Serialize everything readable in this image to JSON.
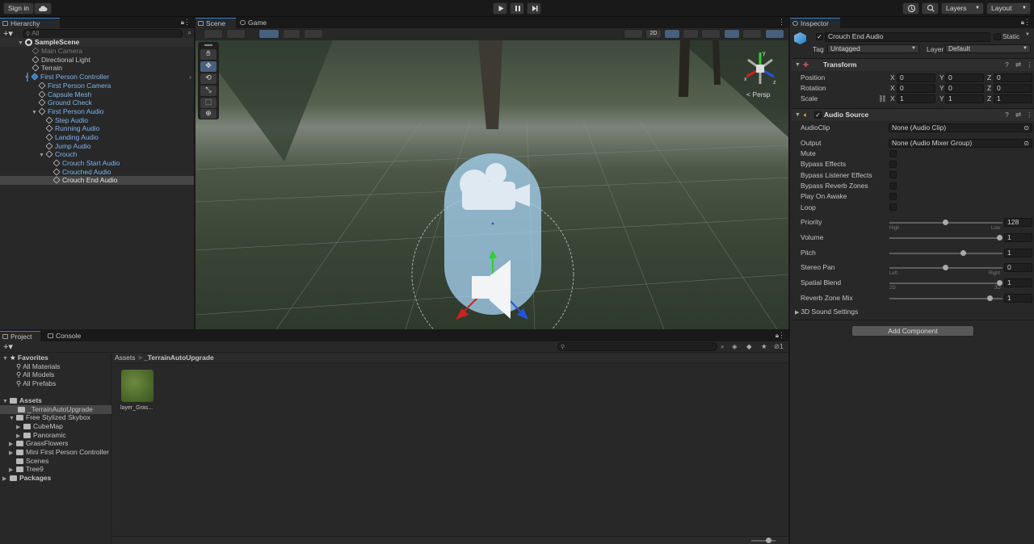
{
  "toolbar": {
    "sign_in": "Sign in",
    "layers": "Layers",
    "layout": "Layout"
  },
  "hierarchy": {
    "tab": "Hierarchy",
    "search_placeholder": "All",
    "scene": "SampleScene",
    "items": [
      "Main Camera",
      "Directional Light",
      "Terrain",
      "First Person Controller",
      "First Person Camera",
      "Capsule Mesh",
      "Ground Check",
      "First Person Audio",
      "Step Audio",
      "Running Audio",
      "Landing Audio",
      "Jump Audio",
      "Crouch",
      "Crouch Start Audio",
      "Crouched Audio",
      "Crouch End Audio"
    ]
  },
  "scene_view": {
    "tab_scene": "Scene",
    "tab_game": "Game",
    "btn_2d": "2D",
    "gizmo_label": "< Persp"
  },
  "project": {
    "tab_project": "Project",
    "tab_console": "Console",
    "favorites_header": "Favorites",
    "favorites": [
      "All Materials",
      "All Models",
      "All Prefabs"
    ],
    "assets_header": "Assets",
    "tree": [
      "_TerrainAutoUpgrade",
      "Free Stylized Skybox",
      "CubeMap",
      "Panoramic",
      "GrassFlowers",
      "Mini First Person Controller",
      "Scenes",
      "Tree9"
    ],
    "packages_header": "Packages",
    "breadcrumb_root": "Assets",
    "breadcrumb_current": "_TerrainAutoUpgrade",
    "asset_label": "layer_Gras...",
    "hidden_count": "1"
  },
  "inspector": {
    "tab": "Inspector",
    "object_name": "Crouch End Audio",
    "static_label": "Static",
    "tag_label": "Tag",
    "tag_value": "Untagged",
    "layer_label": "Layer",
    "layer_value": "Default",
    "transform": {
      "title": "Transform",
      "position_label": "Position",
      "rotation_label": "Rotation",
      "scale_label": "Scale",
      "position": [
        "0",
        "0",
        "0"
      ],
      "rotation": [
        "0",
        "0",
        "0"
      ],
      "scale": [
        "1",
        "1",
        "1"
      ],
      "axis_x": "X",
      "axis_y": "Y",
      "axis_z": "Z"
    },
    "audio_source": {
      "title": "Audio Source",
      "audioclip_label": "AudioClip",
      "audioclip_value": "None (Audio Clip)",
      "output_label": "Output",
      "output_value": "None (Audio Mixer Group)",
      "toggles": [
        "Mute",
        "Bypass Effects",
        "Bypass Listener Effects",
        "Bypass Reverb Zones",
        "Play On Awake",
        "Loop"
      ],
      "priority_label": "Priority",
      "priority_value": "128",
      "priority_high": "High",
      "priority_low": "Low",
      "volume_label": "Volume",
      "volume_value": "1",
      "pitch_label": "Pitch",
      "pitch_value": "1",
      "stereo_label": "Stereo Pan",
      "stereo_value": "0",
      "stereo_left": "Left",
      "stereo_right": "Right",
      "spatial_label": "Spatial Blend",
      "spatial_value": "1",
      "spatial_2d": "2D",
      "spatial_3d": "3D",
      "reverb_label": "Reverb Zone Mix",
      "reverb_value": "1",
      "sound_settings": "3D Sound Settings"
    },
    "add_component": "Add Component"
  },
  "colors": {
    "accent": "#3a79bb",
    "selection": "#2c5d87",
    "hierarchy_blue": "#7fb5ec"
  }
}
